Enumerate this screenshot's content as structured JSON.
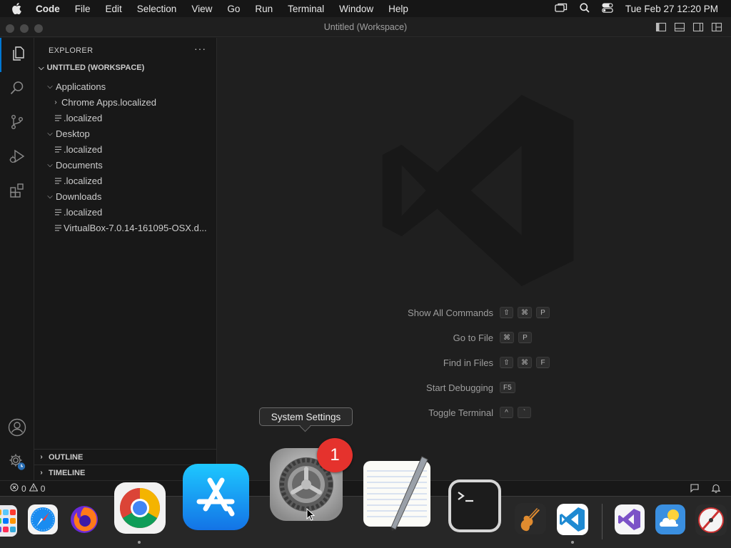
{
  "menubar": {
    "app_name": "Code",
    "menus": [
      "File",
      "Edit",
      "Selection",
      "View",
      "Go",
      "Run",
      "Terminal",
      "Window",
      "Help"
    ],
    "clock": "Tue Feb 27  12:20 PM"
  },
  "window": {
    "title": "Untitled (Workspace)"
  },
  "sidebar": {
    "header": "EXPLORER",
    "more": "···",
    "workspace": "UNTITLED (WORKSPACE)",
    "tree": [
      {
        "label": "Applications",
        "type": "folder",
        "depth": 1,
        "expanded": true
      },
      {
        "label": "Chrome Apps.localized",
        "type": "folder",
        "depth": 2,
        "expanded": false
      },
      {
        "label": ".localized",
        "type": "file",
        "depth": 2
      },
      {
        "label": "Desktop",
        "type": "folder",
        "depth": 1,
        "expanded": true
      },
      {
        "label": ".localized",
        "type": "file",
        "depth": 2
      },
      {
        "label": "Documents",
        "type": "folder",
        "depth": 1,
        "expanded": true
      },
      {
        "label": ".localized",
        "type": "file",
        "depth": 2
      },
      {
        "label": "Downloads",
        "type": "folder",
        "depth": 1,
        "expanded": true
      },
      {
        "label": ".localized",
        "type": "file",
        "depth": 2
      },
      {
        "label": "VirtualBox-7.0.14-161095-OSX.d...",
        "type": "file",
        "depth": 2
      }
    ],
    "outline": "OUTLINE",
    "timeline": "TIMELINE"
  },
  "editor": {
    "hints": [
      {
        "label": "Show All Commands",
        "keys": [
          "⇧",
          "⌘",
          "P"
        ]
      },
      {
        "label": "Go to File",
        "keys": [
          "⌘",
          "P"
        ]
      },
      {
        "label": "Find in Files",
        "keys": [
          "⇧",
          "⌘",
          "F"
        ]
      },
      {
        "label": "Start Debugging",
        "keys": [
          "F5"
        ]
      },
      {
        "label": "Toggle Terminal",
        "keys": [
          "^",
          "`"
        ]
      }
    ]
  },
  "statusbar": {
    "errors": "0",
    "warnings": "0"
  },
  "tooltip": {
    "text": "System Settings"
  },
  "dock": {
    "items": [
      "launchpad-icon",
      "safari-icon",
      "firefox-icon",
      "chrome-icon",
      "app-store-icon",
      "system-settings-icon",
      "textedit-icon",
      "terminal-icon",
      "garageband-icon",
      "vscode-icon",
      "visual-studio-icon",
      "weather-icon",
      "instruments-icon"
    ],
    "settings_badge": "1"
  },
  "colors": {
    "accent": "#0078d4",
    "badge": "#e5322d",
    "vscode_blue": "#1f8ad2"
  }
}
